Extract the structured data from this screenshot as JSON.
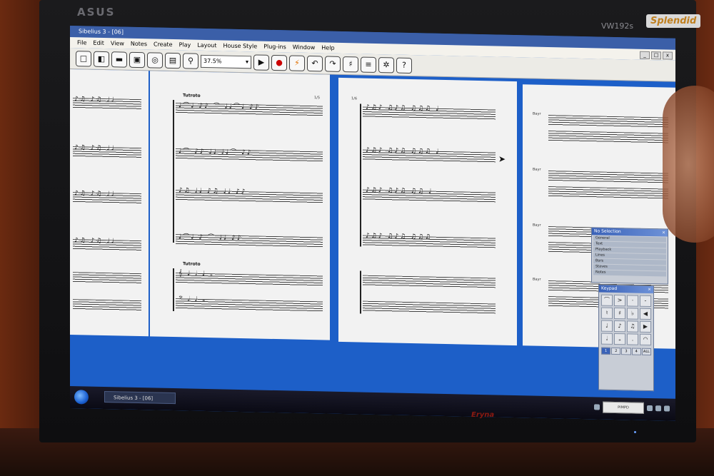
{
  "monitor": {
    "brand": "ASUS",
    "model": "VW192s",
    "badge": "Splendid",
    "stand_logo": "Eryna"
  },
  "window": {
    "title": "Sibelius 3 - [06]",
    "controls": [
      "_",
      "□",
      "x"
    ]
  },
  "menu": [
    "File",
    "Edit",
    "View",
    "Notes",
    "Create",
    "Play",
    "Layout",
    "House Style",
    "Plug-ins",
    "Window",
    "Help"
  ],
  "toolbar": {
    "zoom": "37.5%",
    "icons": [
      "new-icon",
      "open-icon",
      "print-icon",
      "save-icon",
      "navigator-icon",
      "properties-icon",
      "magnify-icon",
      "play-icon",
      "record-icon",
      "flexi-time-icon",
      "undo-icon",
      "redo-icon",
      "mixer-icon",
      "list-icon",
      "settings-icon",
      "help-icon"
    ]
  },
  "score": {
    "page_left_number": "1/5",
    "page_right_number": "1/6",
    "tempo_mark": "Tutroto",
    "instrument": "Bayr"
  },
  "properties_panel": {
    "title": "No Selection",
    "rows": [
      "General",
      "Text",
      "Playback",
      "Lines",
      "Bars",
      "Staves",
      "Notes"
    ]
  },
  "keypad": {
    "title": "Keypad",
    "tabs": [
      "1",
      "2",
      "3",
      "4",
      "ALL"
    ]
  },
  "taskbar": {
    "task": "Sibelius 3 - [06]",
    "tray_text": "PIMPD"
  },
  "colors": {
    "desktop": "#1d5fc8",
    "titlebar": "#3b5fa8",
    "record": "#cc0000"
  }
}
